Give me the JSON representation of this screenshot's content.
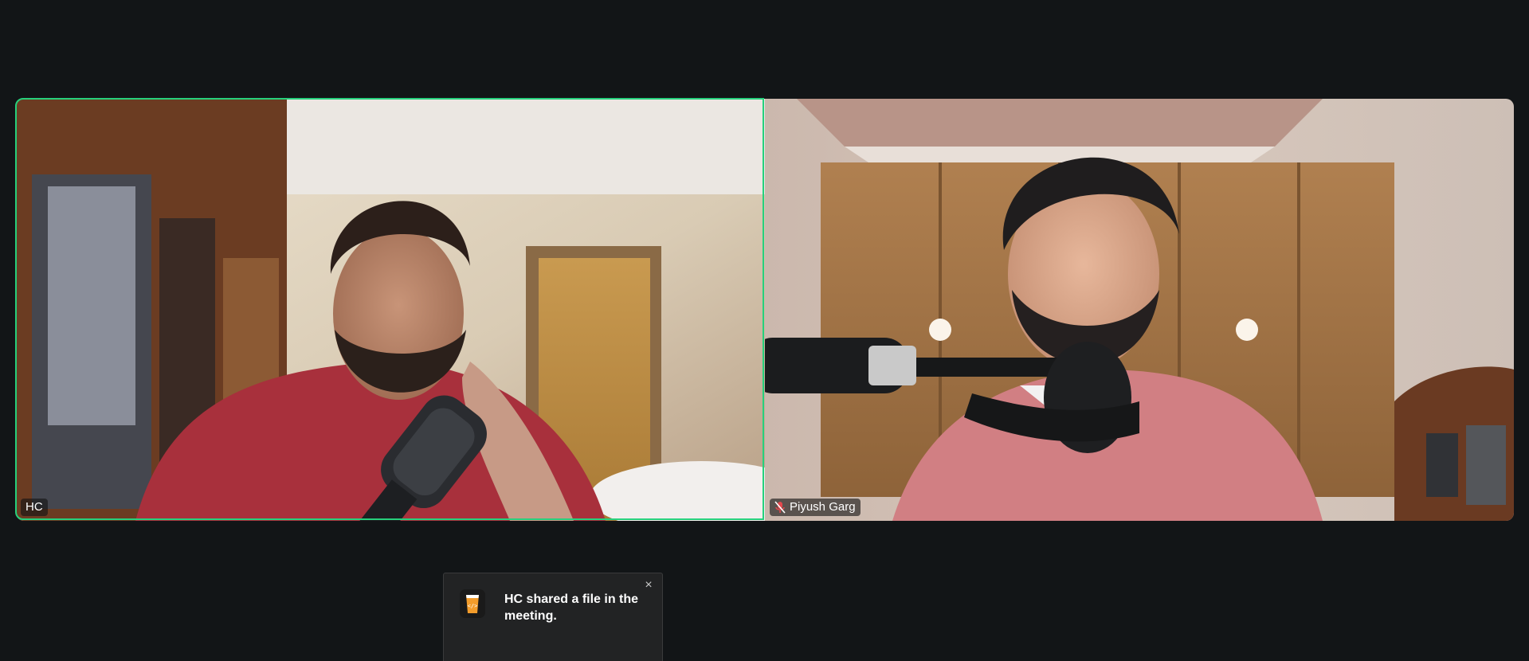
{
  "participants": [
    {
      "name": "HC",
      "active_speaker": true,
      "muted": false
    },
    {
      "name": "Piyush Garg",
      "active_speaker": false,
      "muted": true
    }
  ],
  "notification": {
    "message": "HC shared a file in the meeting.",
    "close_icon": "×",
    "icon": "file-share-icon"
  },
  "colors": {
    "background": "#121517",
    "active_speaker_border": "#26d07c",
    "toast_background": "#222324",
    "muted_icon": "#e5484d"
  }
}
